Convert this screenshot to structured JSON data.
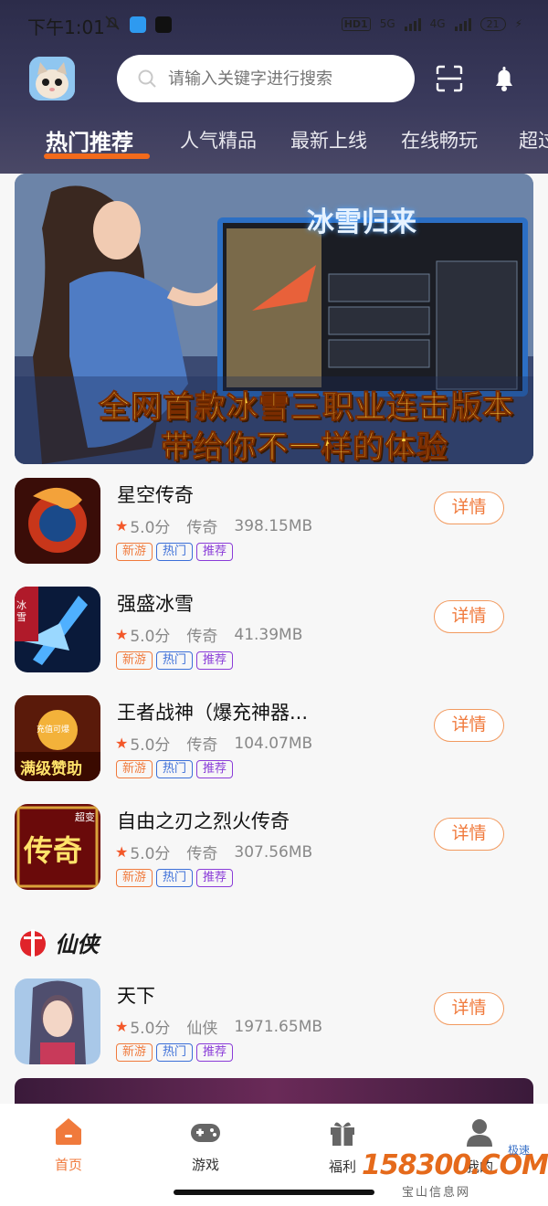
{
  "status_bar": {
    "time": "下午1:01",
    "hd": "HD1",
    "net1": "5G",
    "net2": "4G",
    "battery": "21"
  },
  "search": {
    "placeholder": "请输入关键字进行搜索"
  },
  "tabs": [
    {
      "label": "热门推荐",
      "active": true
    },
    {
      "label": "人气精品"
    },
    {
      "label": "最新上线"
    },
    {
      "label": "在线畅玩"
    },
    {
      "label": "超过"
    }
  ],
  "banner": {
    "title": "冰雪归来",
    "line1": "全网首款冰雪三职业连击版本",
    "line2": "带给你不一样的体验"
  },
  "games": [
    {
      "name": "星空传奇",
      "rating": "5.0分",
      "category": "传奇",
      "size": "398.15MB",
      "tags": [
        "新游",
        "热门",
        "推荐"
      ],
      "button": "详情"
    },
    {
      "name": "强盛冰雪",
      "rating": "5.0分",
      "category": "传奇",
      "size": "41.39MB",
      "tags": [
        "新游",
        "热门",
        "推荐"
      ],
      "button": "详情"
    },
    {
      "name": "王者战神（爆充神器...",
      "rating": "5.0分",
      "category": "传奇",
      "size": "104.07MB",
      "tags": [
        "新游",
        "热门",
        "推荐"
      ],
      "button": "详情"
    },
    {
      "name": "自由之刃之烈火传奇",
      "rating": "5.0分",
      "category": "传奇",
      "size": "307.56MB",
      "tags": [
        "新游",
        "热门",
        "推荐"
      ],
      "button": "详情"
    }
  ],
  "section": {
    "title": "仙侠",
    "games": [
      {
        "name": "天下",
        "rating": "5.0分",
        "category": "仙侠",
        "size": "1971.65MB",
        "tags": [
          "新游",
          "热门",
          "推荐"
        ],
        "button": "详情"
      }
    ]
  },
  "icon_texts": {
    "game2_badge": "冰雪",
    "game3_top": "充值可爆",
    "game3_bottom": "满级赞助",
    "game4_main": "传奇",
    "game4_badge": "超变"
  },
  "tabbar": [
    {
      "label": "首页",
      "icon": "home-icon",
      "active": true
    },
    {
      "label": "游戏",
      "icon": "gamepad-icon"
    },
    {
      "label": "福利",
      "icon": "gift-icon"
    },
    {
      "label": "我的",
      "icon": "user-icon"
    }
  ],
  "watermark": {
    "main": "158300.COM",
    "small": "极速",
    "sub": "宝山信息网"
  },
  "colors": {
    "accent": "#f07a3c",
    "header": "#2c2c4a",
    "tag_new": "#f07a3c",
    "tag_hot": "#3c6fd8",
    "tag_rec": "#8a3cd8"
  }
}
